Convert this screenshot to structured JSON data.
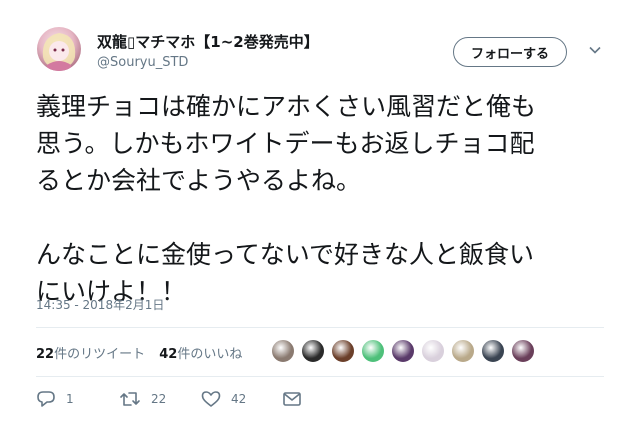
{
  "user": {
    "display_name": "双龍▯マチマホ【1~2巻発売中】",
    "handle": "@Souryu_STD"
  },
  "follow_button": {
    "label": "フォローする"
  },
  "tweet": {
    "text": "義理チョコは確かにアホくさい風習だと俺も\n思う。しかもホワイトデーもお返しチョコ配\nるとか会社でようやるよね。\n\nんなことに金使ってないで好きな人と飯食い\nにいけよ！！",
    "timestamp": "14:35 - 2018年2月1日"
  },
  "stats": {
    "retweets": {
      "count": "22",
      "label": "件のリツイート"
    },
    "likes": {
      "count": "42",
      "label": "件のいいね"
    }
  },
  "liker_avatars": [
    {
      "color": "#8a7a70"
    },
    {
      "color": "#2a2a2a"
    },
    {
      "color": "#6b3f2a"
    },
    {
      "color": "#4ec07a"
    },
    {
      "color": "#5a3a6a"
    },
    {
      "color": "#d9d0dc"
    },
    {
      "color": "#b9a98a"
    },
    {
      "color": "#3a4452"
    },
    {
      "color": "#6a3f5a"
    }
  ],
  "actions": {
    "reply": {
      "icon": "reply-icon",
      "count": "1"
    },
    "retweet": {
      "icon": "retweet-icon",
      "count": "22"
    },
    "like": {
      "icon": "heart-icon",
      "count": "42"
    },
    "message": {
      "icon": "envelope-icon"
    }
  }
}
